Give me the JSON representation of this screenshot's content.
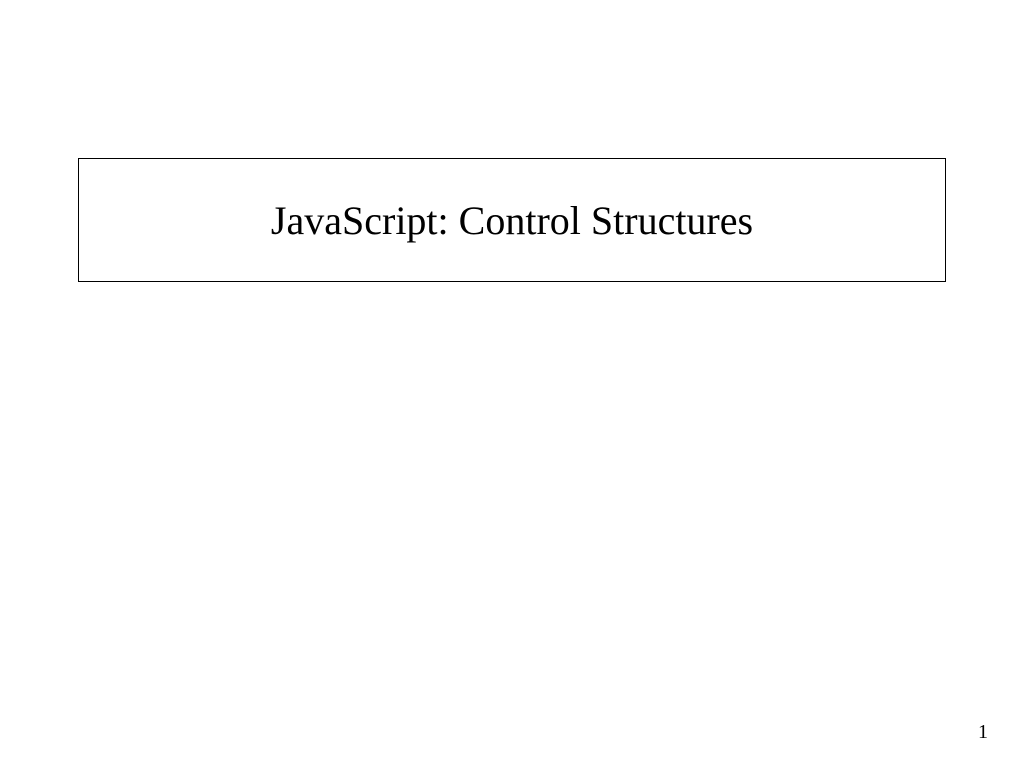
{
  "slide": {
    "title": "JavaScript: Control Structures",
    "page_number": "1"
  }
}
